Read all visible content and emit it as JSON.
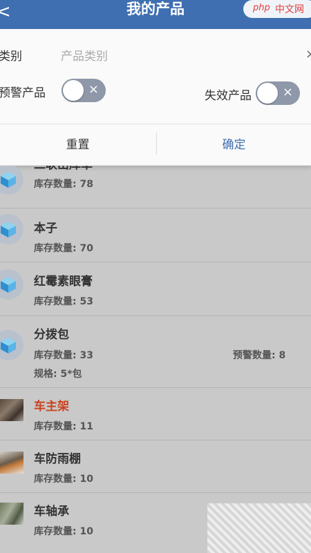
{
  "header": {
    "back_icon": "<",
    "title": "我的产品",
    "logo_php": "php",
    "logo_cn": "中文网"
  },
  "filter": {
    "category_label": "类别",
    "category_placeholder": "产品类别",
    "close_icon": "×",
    "warn_label": "预警产品",
    "expired_label": "失效产品",
    "toggle_x": "×",
    "reset_label": "重置",
    "confirm_label": "确定"
  },
  "items": [
    {
      "name": "二联出库单",
      "stock": "库存数量: 78"
    },
    {
      "name": "本子",
      "stock": "库存数量: 70"
    },
    {
      "name": "红霉素眼膏",
      "stock": "库存数量: 53"
    },
    {
      "name": "分拨包",
      "stock": "库存数量: 33",
      "warn": "预警数量: 8",
      "spec": "规格: 5*包"
    },
    {
      "name": "车主架",
      "stock": "库存数量: 11"
    },
    {
      "name": "车防雨棚",
      "stock": "库存数量: 10"
    },
    {
      "name": "车轴承",
      "stock": "库存数量: 10"
    }
  ],
  "colors": {
    "accent": "#3f6fb0",
    "highlight_name": "#c9431f"
  }
}
